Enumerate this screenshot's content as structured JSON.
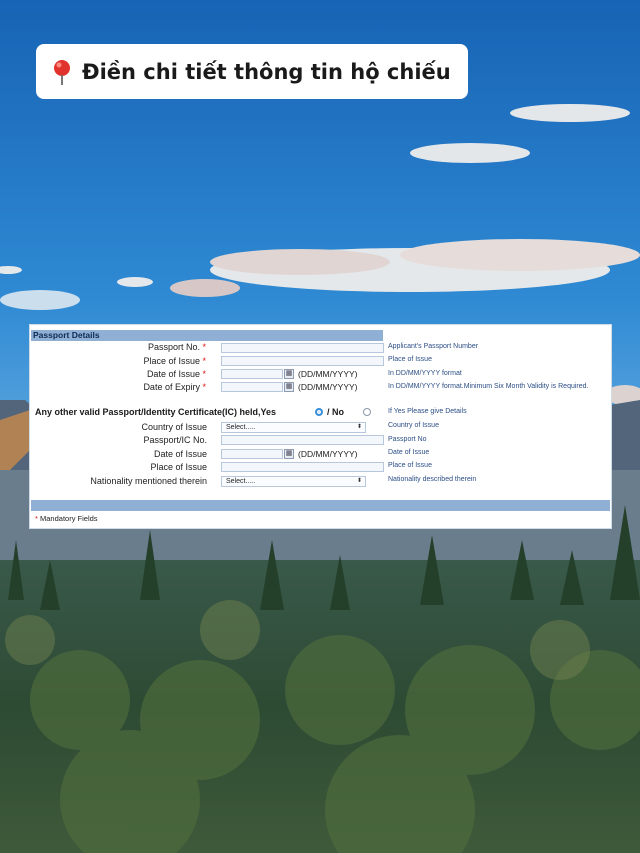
{
  "title": {
    "pin_icon": "round-pushpin-icon",
    "text": "Điền chi tiết thông tin hộ chiếu"
  },
  "form": {
    "section_header": "Passport Details",
    "passport_no": {
      "label": "Passport No.",
      "req": "*",
      "hint": "Applicant's Passport Number"
    },
    "place_of_issue": {
      "label": "Place of Issue",
      "req": "*",
      "hint": "Place of Issue"
    },
    "date_of_issue": {
      "label": "Date of Issue",
      "req": "*",
      "format": "(DD/MM/YYYY)",
      "hint": "In DD/MM/YYYY format"
    },
    "date_of_expiry": {
      "label": "Date of Expiry",
      "req": "*",
      "format": "(DD/MM/YYYY)",
      "hint": "In DD/MM/YYYY format.Minimum Six Month Validity is Required."
    },
    "question": "Any other valid Passport/Identity Certificate(IC) held,Yes",
    "no_label": "/ No",
    "question_hint": "If Yes Please give Details",
    "other": {
      "country_of_issue": {
        "label": "Country of Issue",
        "value": "Select.....",
        "hint": "Country of Issue"
      },
      "passport_ic_no": {
        "label": "Passport/IC No.",
        "hint": "Passport No"
      },
      "date_of_issue": {
        "label": "Date of Issue",
        "format": "(DD/MM/YYYY)",
        "hint": "Date of Issue"
      },
      "place_of_issue": {
        "label": "Place of Issue",
        "hint": "Place of Issue"
      },
      "nationality": {
        "label": "Nationality mentioned therein",
        "value": "Select.....",
        "hint": "Nationality described therein"
      }
    },
    "mandatory_req": "*",
    "mandatory_note": "Mandatory Fields",
    "colors": {
      "header_bar": "#8fb0d4",
      "hint_text": "#2b4e86",
      "required": "#dd1111"
    }
  }
}
